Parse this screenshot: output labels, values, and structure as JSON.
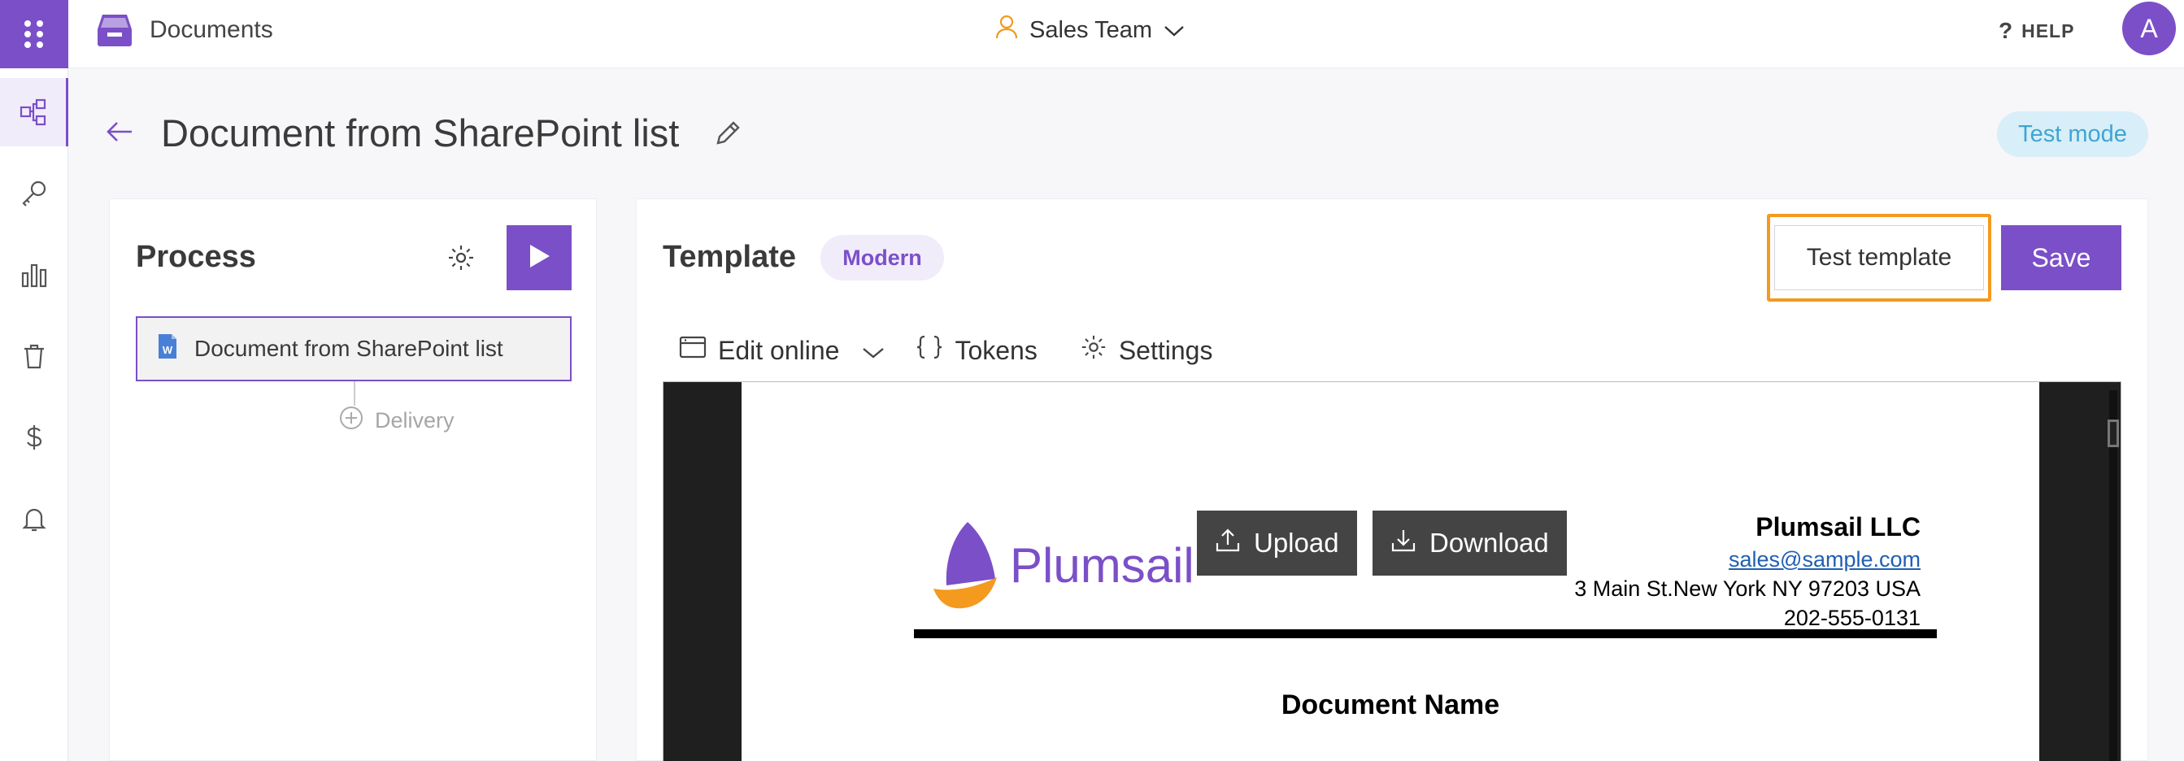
{
  "app": {
    "title": "Documents"
  },
  "team": {
    "label": "Sales Team"
  },
  "help": {
    "label": "HELP"
  },
  "user": {
    "initial": "A"
  },
  "page": {
    "title": "Document from SharePoint list",
    "mode_badge": "Test mode"
  },
  "process": {
    "title": "Process",
    "steps": [
      {
        "label": "Document from SharePoint list"
      }
    ],
    "add_delivery_label": "Delivery"
  },
  "template": {
    "title": "Template",
    "badge": "Modern",
    "test_button": "Test template",
    "save_button": "Save",
    "toolbar": {
      "edit_online": "Edit online",
      "tokens": "Tokens",
      "settings": "Settings"
    }
  },
  "preview": {
    "upload_button": "Upload",
    "download_button": "Download",
    "logo_text": "Plumsail",
    "company_name": "Plumsail LLC",
    "email": "sales@sample.com",
    "address": "3 Main St.New York NY 97203 USA",
    "phone": "202-555-0131",
    "document_name": "Document Name"
  },
  "colors": {
    "accent": "#7b4fc8",
    "highlight": "#f39a1f",
    "test_mode_bg": "#d8eef8",
    "test_mode_text": "#3fa5d3"
  }
}
